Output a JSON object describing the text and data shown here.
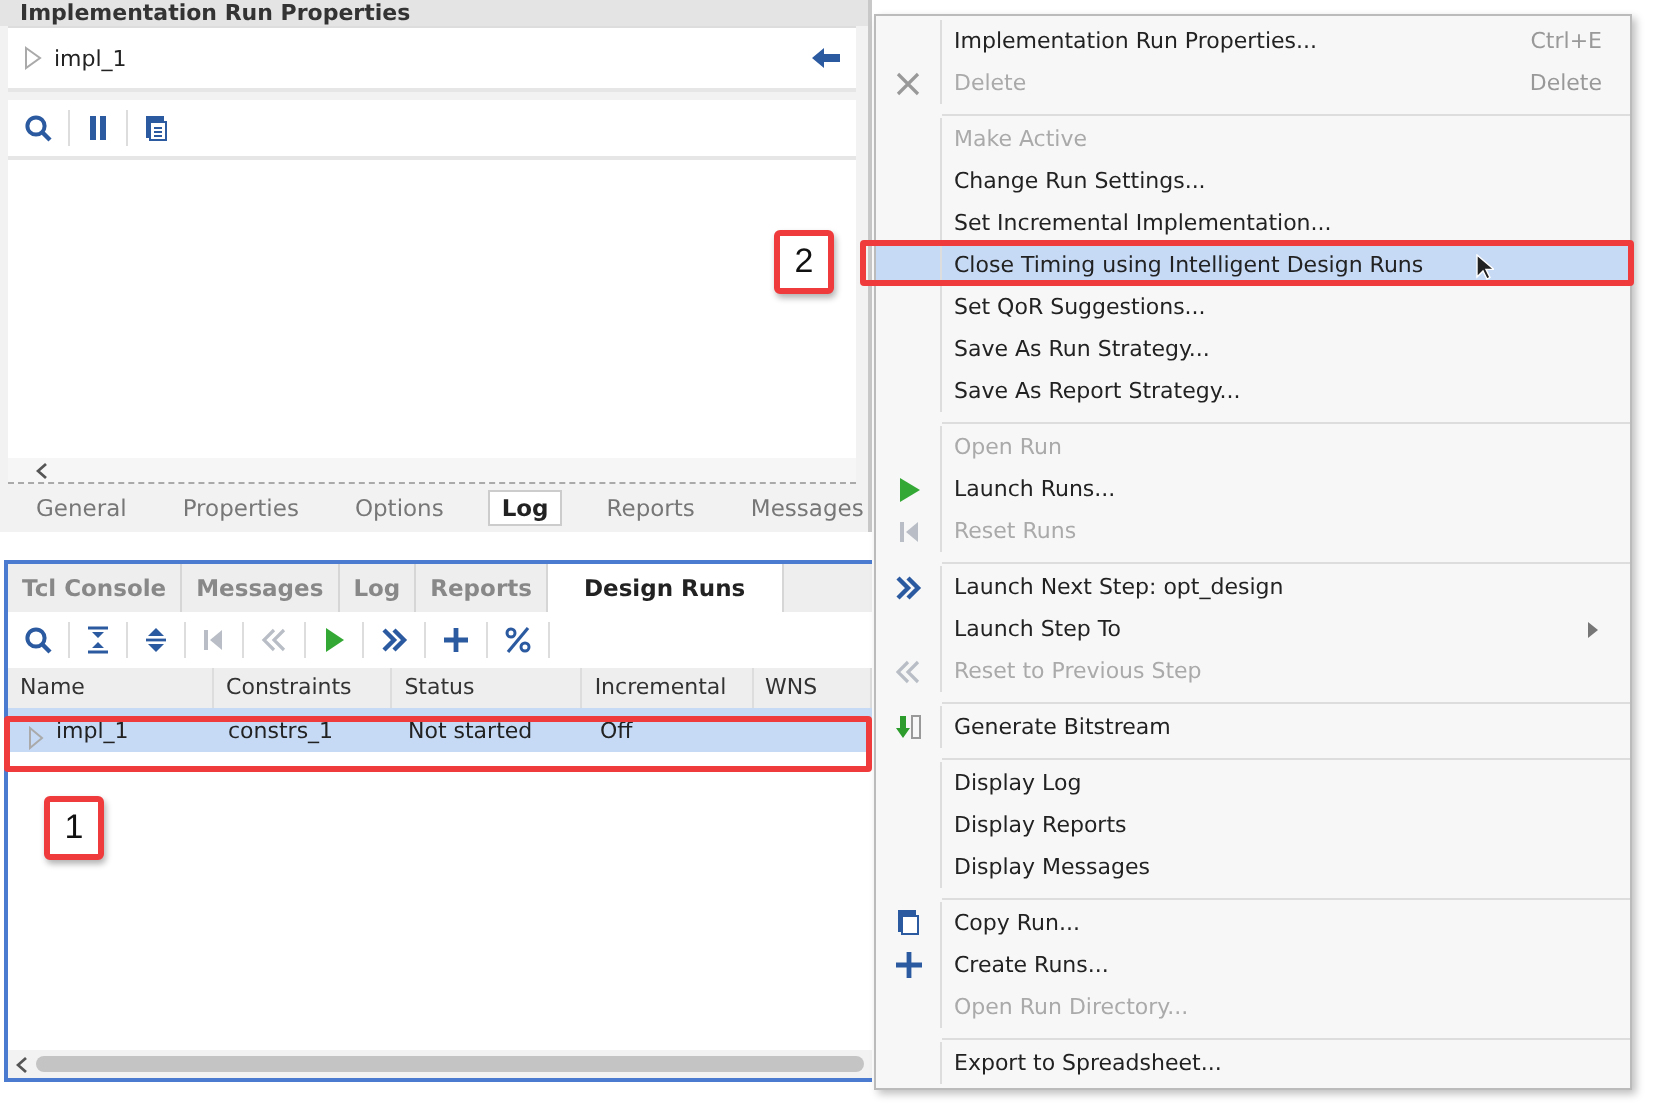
{
  "properties_panel": {
    "title": "Implementation Run Properties",
    "run_name": "impl_1",
    "tabs": [
      {
        "label": "General",
        "selected": false
      },
      {
        "label": "Properties",
        "selected": false
      },
      {
        "label": "Options",
        "selected": false
      },
      {
        "label": "Log",
        "selected": true
      },
      {
        "label": "Reports",
        "selected": false
      },
      {
        "label": "Messages",
        "selected": false
      }
    ]
  },
  "runs_panel": {
    "tabs": [
      {
        "label": "Tcl Console",
        "selected": false
      },
      {
        "label": "Messages",
        "selected": false
      },
      {
        "label": "Log",
        "selected": false
      },
      {
        "label": "Reports",
        "selected": false
      },
      {
        "label": "Design Runs",
        "selected": true
      }
    ],
    "table": {
      "columns": [
        "Name",
        "Constraints",
        "Status",
        "Incremental",
        "WNS"
      ],
      "rows": [
        {
          "cells": [
            "impl_1",
            "constrs_1",
            "Not started",
            "Off"
          ],
          "selected": true
        }
      ]
    }
  },
  "context_menu": {
    "groups": [
      [
        {
          "label": "Implementation Run Properties...",
          "shortcut": "Ctrl+E",
          "disabled": false,
          "selected": false
        },
        {
          "label": "Delete",
          "shortcut": "Delete",
          "disabled": true,
          "selected": false
        }
      ],
      [
        {
          "label": "Make Active",
          "disabled": true,
          "selected": false
        },
        {
          "label": "Change Run Settings...",
          "disabled": false,
          "selected": false
        },
        {
          "label": "Set Incremental Implementation...",
          "disabled": false,
          "selected": false
        },
        {
          "label": "Close Timing using Intelligent Design Runs",
          "disabled": false,
          "selected": true
        },
        {
          "label": "Set QoR Suggestions...",
          "disabled": false,
          "selected": false
        },
        {
          "label": "Save As Run Strategy...",
          "disabled": false,
          "selected": false
        },
        {
          "label": "Save As Report Strategy...",
          "disabled": false,
          "selected": false
        }
      ],
      [
        {
          "label": "Open Run",
          "disabled": true,
          "selected": false
        },
        {
          "label": "Launch Runs...",
          "disabled": false,
          "selected": false
        },
        {
          "label": "Reset Runs",
          "disabled": true,
          "selected": false
        }
      ],
      [
        {
          "label": "Launch Next Step: opt_design",
          "disabled": false,
          "selected": false
        },
        {
          "label": "Launch Step To",
          "disabled": false,
          "selected": false,
          "submenu": true
        },
        {
          "label": "Reset to Previous Step",
          "disabled": true,
          "selected": false
        }
      ],
      [
        {
          "label": "Generate Bitstream",
          "disabled": false,
          "selected": false
        }
      ],
      [
        {
          "label": "Display Log",
          "disabled": false,
          "selected": false
        },
        {
          "label": "Display Reports",
          "disabled": false,
          "selected": false
        },
        {
          "label": "Display Messages",
          "disabled": false,
          "selected": false
        }
      ],
      [
        {
          "label": "Copy Run...",
          "disabled": false,
          "selected": false
        },
        {
          "label": "Create Runs...",
          "disabled": false,
          "selected": false
        },
        {
          "label": "Open Run Directory...",
          "disabled": true,
          "selected": false
        }
      ],
      [
        {
          "label": "Export to Spreadsheet...",
          "disabled": false,
          "selected": false
        }
      ]
    ]
  },
  "callouts": [
    {
      "label": "1"
    },
    {
      "label": "2"
    }
  ]
}
